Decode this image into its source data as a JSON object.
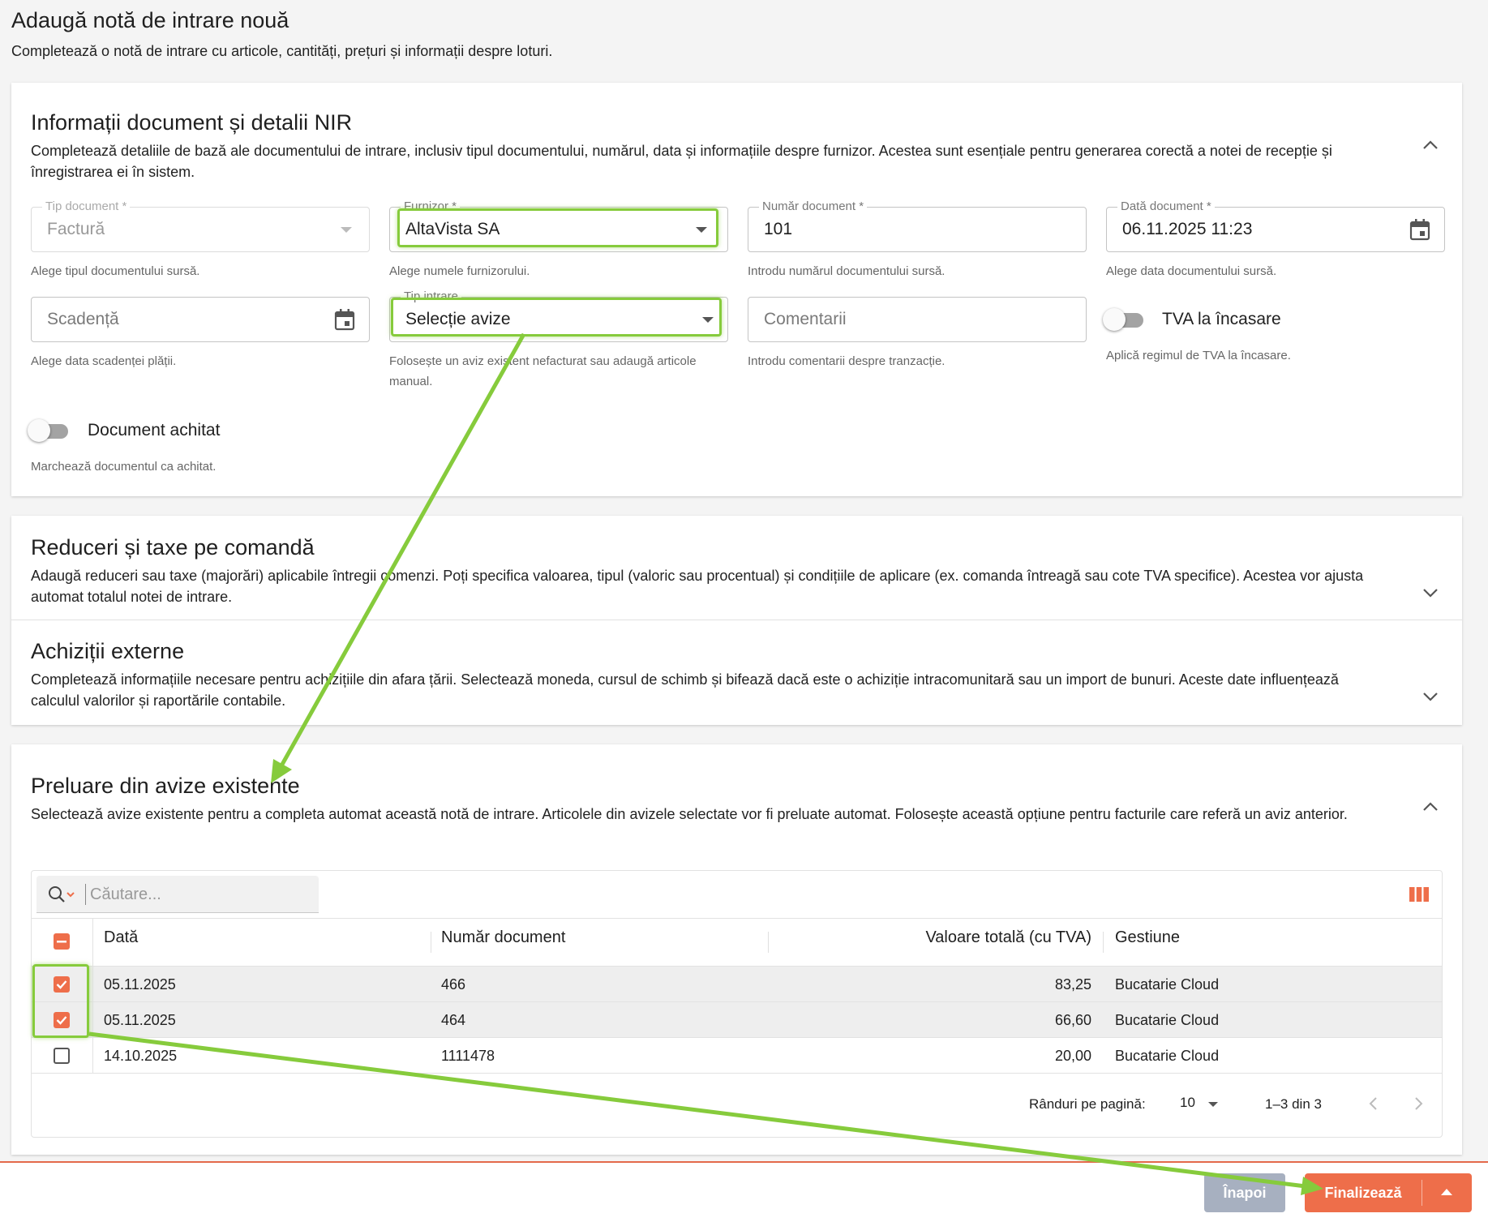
{
  "page": {
    "title": "Adaugă notă de intrare nouă",
    "subtitle": "Completează o notă de intrare cu articole, cantități, prețuri și informații despre loturi."
  },
  "doc_section": {
    "title": "Informații document și detalii NIR",
    "description": "Completează detaliile de bază ale documentului de intrare, inclusiv tipul documentului, numărul, data și informațiile despre furnizor. Acestea sunt esențiale pentru generarea corectă a notei de recepție și înregistrarea ei în sistem.",
    "fields": {
      "tip_document": {
        "label": "Tip document *",
        "value": "Factură",
        "helper": "Alege tipul documentului sursă."
      },
      "furnizor": {
        "label": "Furnizor *",
        "value": "AltaVista SA",
        "helper": "Alege numele furnizorului."
      },
      "numar_document": {
        "label": "Număr document *",
        "value": "101",
        "helper": "Introdu numărul documentului sursă."
      },
      "data_document": {
        "label": "Dată document *",
        "value": "06.11.2025 11:23",
        "helper": "Alege data documentului sursă."
      },
      "scadenta": {
        "placeholder": "Scadență",
        "helper": "Alege data scadenței plății."
      },
      "tip_intrare": {
        "label": "Tip intrare",
        "value": "Selecție avize",
        "helper": "Folosește un aviz existent nefacturat sau adaugă articole manual."
      },
      "comentarii": {
        "placeholder": "Comentarii",
        "helper": "Introdu comentarii despre tranzacție."
      }
    },
    "toggles": {
      "tva_incasare": {
        "label": "TVA la încasare",
        "helper": "Aplică regimul de TVA la încasare.",
        "checked": false
      },
      "document_achitat": {
        "label": "Document achitat",
        "helper": "Marchează documentul ca achitat.",
        "checked": false
      }
    }
  },
  "discount_section": {
    "title": "Reduceri și taxe pe comandă",
    "description": "Adaugă reduceri sau taxe (majorări) aplicabile întregii comenzi. Poți specifica valoarea, tipul (valoric sau procentual) și condițiile de aplicare (ex. comanda întreagă sau cote TVA specifice). Acestea vor ajusta automat totalul notei de intrare."
  },
  "external_section": {
    "title": "Achiziții externe",
    "description": "Completează informațiile necesare pentru achizițiile din afara țării. Selectează moneda, cursul de schimb și bifează dacă este o achiziție intracomunitară sau un import de bunuri. Aceste date influențează calculul valorilor și raportările contabile."
  },
  "avize_section": {
    "title": "Preluare din avize existente",
    "description": "Selectează avize existente pentru a completa automat această notă de intrare. Articolele din avizele selectate vor fi preluate automat. Folosește această opțiune pentru facturile care referă un aviz anterior.",
    "search_placeholder": "Căutare...",
    "columns": [
      "Dată",
      "Număr document",
      "Valoare totală (cu TVA)",
      "Gestiune"
    ],
    "rows": [
      {
        "data": "05.11.2025",
        "numar": "466",
        "valoare": "83,25",
        "gestiune": "Bucatarie Cloud",
        "selected": true
      },
      {
        "data": "05.11.2025",
        "numar": "464",
        "valoare": "66,60",
        "gestiune": "Bucatarie Cloud",
        "selected": true
      },
      {
        "data": "14.10.2025",
        "numar": "1111478",
        "valoare": "20,00",
        "gestiune": "Bucatarie Cloud",
        "selected": false
      }
    ],
    "pagination": {
      "rows_per_page_label": "Rânduri pe pagină:",
      "rows_per_page": "10",
      "range": "1–3 din 3"
    }
  },
  "footer": {
    "back_label": "Înapoi",
    "finish_label": "Finalizează"
  },
  "colors": {
    "accent": "#ee6e4a",
    "highlight": "#86cb3c",
    "back_button": "#a7b0c0"
  },
  "icons": [
    "calendar-icon",
    "chevron-up-icon",
    "chevron-down-icon",
    "search-icon",
    "columns-icon",
    "chevron-left-icon",
    "chevron-right-icon",
    "checkbox-checked-icon",
    "checkbox-indeterminate-icon",
    "caret-up-icon"
  ]
}
